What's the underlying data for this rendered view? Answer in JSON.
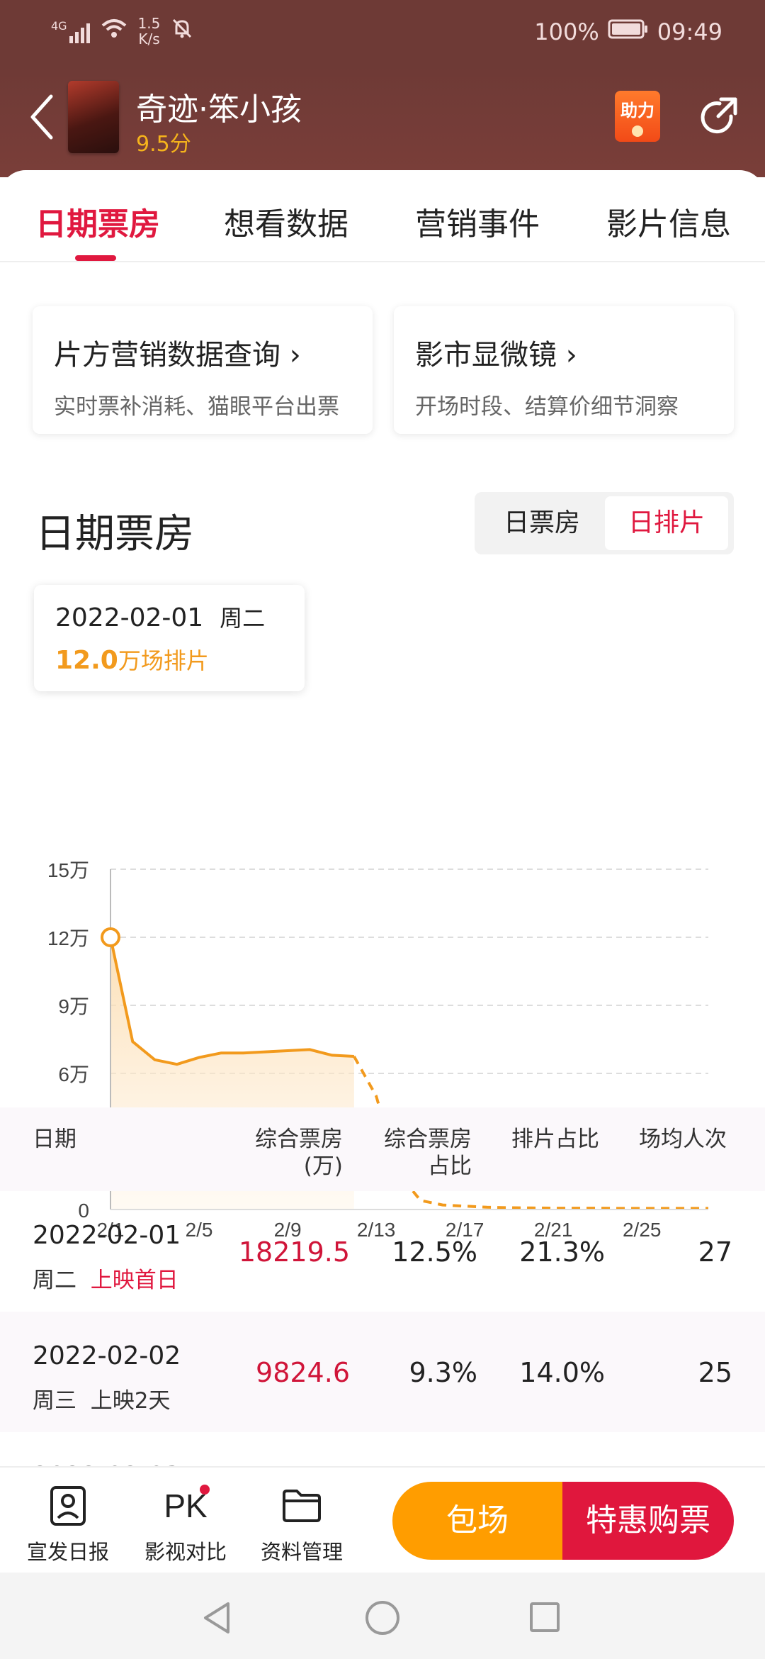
{
  "status": {
    "network": "4G",
    "speed_value": "1.5",
    "speed_unit": "K/s",
    "battery": "100%",
    "time": "09:49"
  },
  "header": {
    "title": "奇迹·笨小孩",
    "score": "9.5分",
    "help_label": "助力"
  },
  "tabs": [
    {
      "label": "日期票房"
    },
    {
      "label": "想看数据"
    },
    {
      "label": "营销事件"
    },
    {
      "label": "影片信息"
    }
  ],
  "features": [
    {
      "title": "片方营销数据查询 ›",
      "subtitle": "实时票补消耗、猫眼平台出票"
    },
    {
      "title": "影市显微镜 ›",
      "subtitle": "开场时段、结算价细节洞察"
    }
  ],
  "section": {
    "title": "日期票房",
    "toggle": [
      "日票房",
      "日排片"
    ]
  },
  "tooltip": {
    "date": "2022-02-01",
    "weekday": "周二",
    "value": "12.0",
    "unit": "万场排片"
  },
  "chart_data": {
    "type": "line",
    "x": [
      "2/1",
      "2/2",
      "2/3",
      "2/4",
      "2/5",
      "2/6",
      "2/7",
      "2/8",
      "2/9",
      "2/10",
      "2/11",
      "2/12",
      "2/13",
      "2/14",
      "2/15",
      "2/16",
      "2/17",
      "2/18",
      "2/19",
      "2/20",
      "2/21",
      "2/22",
      "2/23",
      "2/24",
      "2/25",
      "2/26",
      "2/27",
      "2/28"
    ],
    "values": [
      12.0,
      7.4,
      6.6,
      6.4,
      6.7,
      6.9,
      6.9,
      6.95,
      7.0,
      7.05,
      6.8,
      6.75,
      5.0,
      1.6,
      0.4,
      0.2,
      0.15,
      0.1,
      0.08,
      0.07,
      0.06,
      0.06,
      0.06,
      0.05,
      0.05,
      0.05,
      0.05,
      0.05
    ],
    "solid_until": "2/12",
    "ylim": [
      0,
      15
    ],
    "y_ticks": [
      "0",
      "3万",
      "6万",
      "9万",
      "12万",
      "15万"
    ],
    "x_ticks": [
      "2/1",
      "2/5",
      "2/9",
      "2/13",
      "2/17",
      "2/21",
      "2/25"
    ],
    "highlight": "2/1",
    "color": "#f29a1d",
    "grid": true
  },
  "table": {
    "headers": [
      "日期",
      "综合票房\n(万)",
      "综合票房\n占比",
      "排片占比",
      "场均人次"
    ],
    "rows": [
      {
        "date": "2022-02-01",
        "weekday": "周二",
        "note": "上映首日",
        "box": "18219.5",
        "box_ratio": "12.5%",
        "show_ratio": "21.3%",
        "avg": "27"
      },
      {
        "date": "2022-02-02",
        "weekday": "周三",
        "note": "上映2天",
        "box": "9824.6",
        "box_ratio": "9.3%",
        "show_ratio": "14.0%",
        "avg": "25"
      }
    ],
    "partial_row_date": "2022-02-03"
  },
  "bottombar": {
    "items": [
      {
        "label": "宣发日报"
      },
      {
        "label": "影视对比",
        "icon_text": "PK"
      },
      {
        "label": "资料管理"
      }
    ],
    "book_label": "包场",
    "buy_label": "特惠购票"
  }
}
